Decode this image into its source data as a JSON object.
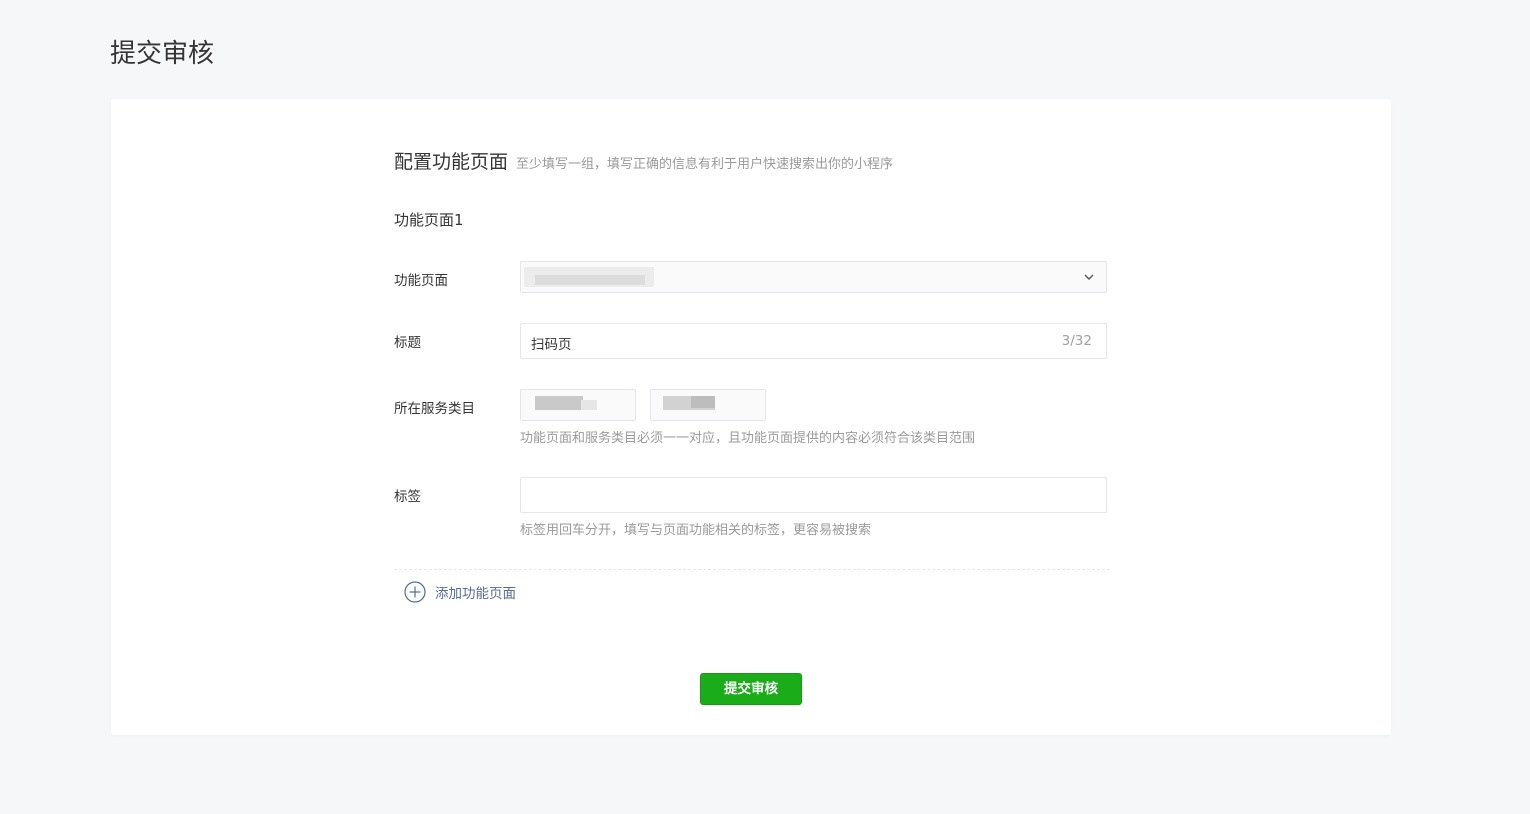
{
  "page": {
    "title": "提交审核"
  },
  "section": {
    "title": "配置功能页面",
    "description": "至少填写一组，填写正确的信息有利于用户快速搜索出你的小程序"
  },
  "group": {
    "title": "功能页面1"
  },
  "form": {
    "page_label": "功能页面",
    "title_label": "标题",
    "title_value": "扫码页",
    "title_counter": "3/32",
    "category_label": "所在服务类目",
    "category_hint": "功能页面和服务类目必须一一对应，且功能页面提供的内容必须符合该类目范围",
    "tag_label": "标签",
    "tag_value": "",
    "tag_hint": "标签用回车分开，填写与页面功能相关的标签，更容易被搜索"
  },
  "actions": {
    "add_page_label": "添加功能页面",
    "submit_label": "提交审核"
  },
  "icons": {
    "select_arrow": "chevron-down-icon",
    "add": "plus-circle-icon"
  },
  "colors": {
    "primary_button": "#1aad19",
    "link": "#576b95",
    "background": "#f6f7f9"
  }
}
